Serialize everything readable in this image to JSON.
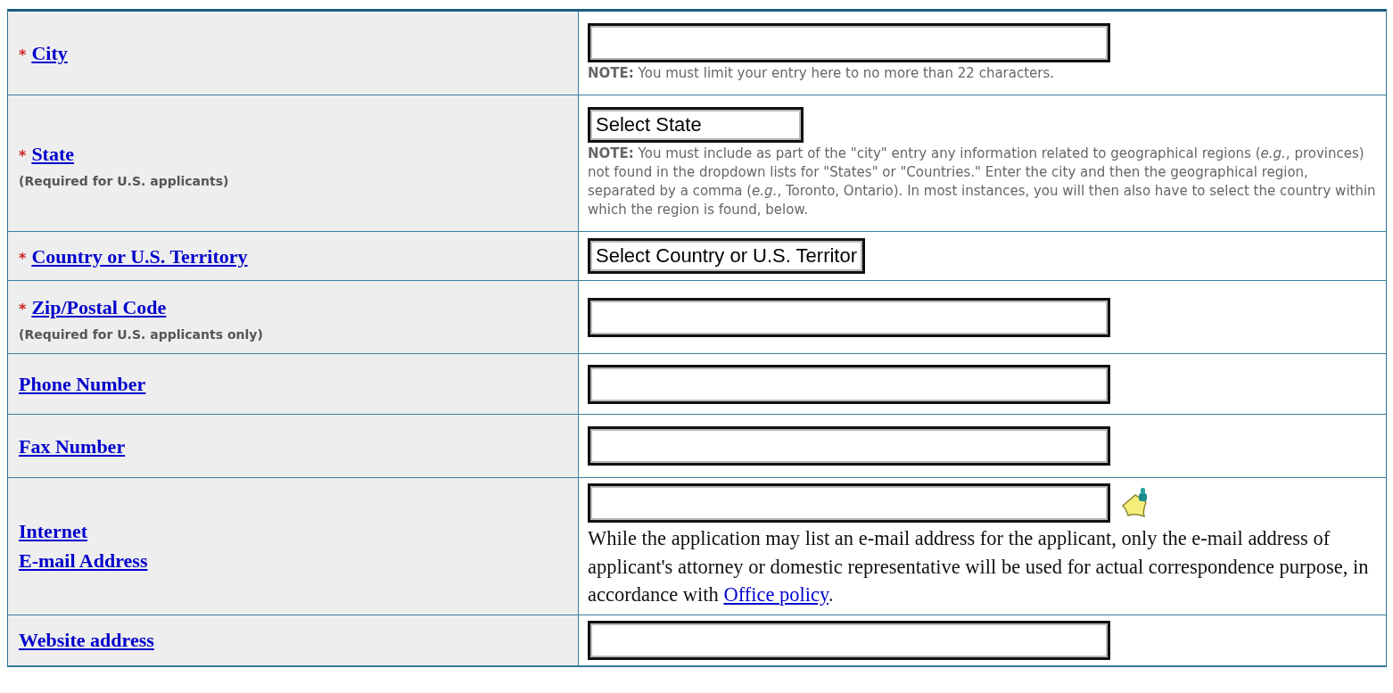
{
  "rows": [
    {
      "label": "City",
      "required_mark": "*",
      "field": {
        "kind": "text"
      },
      "note": {
        "kind": "small",
        "text": "**NOTE:** You must limit your entry here to no more than 22 characters."
      }
    },
    {
      "label": "State",
      "required_mark": "*",
      "subnote": "(Required for U.S. applicants)",
      "field": {
        "kind": "select",
        "value": "Select State"
      },
      "note": {
        "kind": "small",
        "text": "**NOTE:** You must include as part of the \"city\" entry any information related to geographical regions (*e.g.*, provinces) not found in the dropdown lists for \"States\" or \"Countries.\" Enter the city and then the geographical region, separated by a comma (*e.g.*, Toronto, Ontario). In most instances, you will then also have to select the country within which the region is found, below."
      }
    },
    {
      "label": "Country or U.S. Territory",
      "required_mark": "*",
      "field": {
        "kind": "select",
        "value": "Select Country or U.S. Territor"
      }
    },
    {
      "label": "Zip/Postal Code",
      "required_mark": "*",
      "subnote": "(Required for U.S. applicants only)",
      "field": {
        "kind": "text"
      }
    },
    {
      "label": "Phone Number",
      "field": {
        "kind": "text"
      }
    },
    {
      "label": "Fax Number",
      "field": {
        "kind": "text"
      }
    },
    {
      "label": "Internet \nE-mail Address",
      "field": {
        "kind": "text-icon"
      },
      "note": {
        "kind": "serif",
        "text": "While the application may list an e-mail address for the applicant, only the e-mail address of applicant's attorney or domestic representative will be used for actual correspondence purpose, in accordance with",
        "link": "Office policy",
        "after": "."
      }
    },
    {
      "label": "Website address",
      "field": {
        "kind": "text"
      }
    }
  ]
}
